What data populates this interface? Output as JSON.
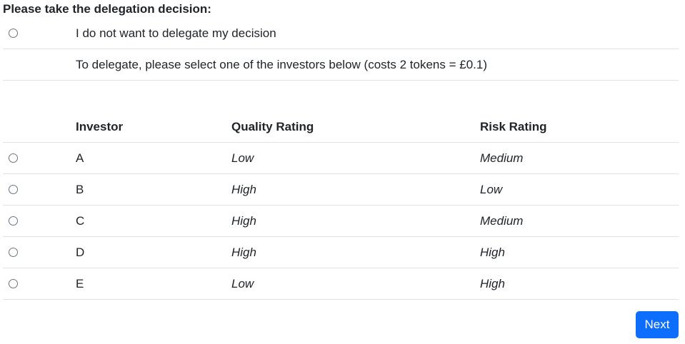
{
  "heading": "Please take the delegation decision:",
  "no_delegate_option": "I do not want to delegate my decision",
  "delegate_instruction": "To delegate, please select one of the investors below (costs 2 tokens = £0.1)",
  "table": {
    "headers": {
      "investor": "Investor",
      "quality": "Quality Rating",
      "risk": "Risk Rating"
    },
    "rows": [
      {
        "investor": "A",
        "quality": "Low",
        "risk": "Medium"
      },
      {
        "investor": "B",
        "quality": "High",
        "risk": "Low"
      },
      {
        "investor": "C",
        "quality": "High",
        "risk": "Medium"
      },
      {
        "investor": "D",
        "quality": "High",
        "risk": "High"
      },
      {
        "investor": "E",
        "quality": "Low",
        "risk": "High"
      }
    ]
  },
  "next_button": "Next",
  "colors": {
    "primary": "#0d6efd",
    "border": "#dee2e6",
    "text": "#212529"
  }
}
